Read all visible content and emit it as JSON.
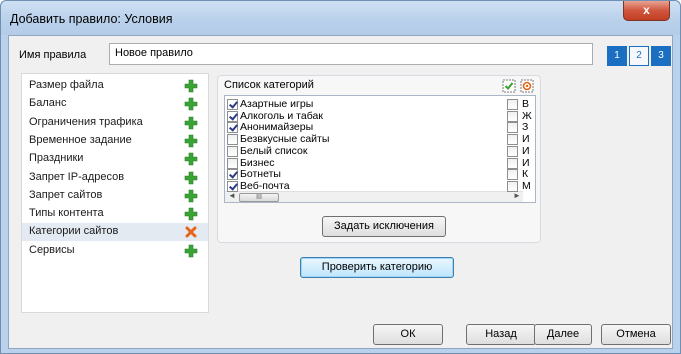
{
  "window": {
    "title": "Добавить правило: Условия",
    "close_glyph": "x"
  },
  "rule_name": {
    "label": "Имя правила",
    "value": "Новое правило"
  },
  "steps": [
    "1",
    "2",
    "3"
  ],
  "sidebar": {
    "items": [
      {
        "label": "Размер файла",
        "icon": "plus-icon"
      },
      {
        "label": "Баланс",
        "icon": "plus-icon"
      },
      {
        "label": "Ограничения трафика",
        "icon": "plus-icon"
      },
      {
        "label": "Временное задание",
        "icon": "plus-icon"
      },
      {
        "label": "Праздники",
        "icon": "plus-icon"
      },
      {
        "label": "Запрет IP-адресов",
        "icon": "plus-icon"
      },
      {
        "label": "Запрет сайтов",
        "icon": "plus-icon"
      },
      {
        "label": "Типы контента",
        "icon": "plus-icon"
      },
      {
        "label": "Категории сайтов",
        "icon": "remove-icon",
        "selected": true
      },
      {
        "label": "Сервисы",
        "icon": "plus-icon"
      }
    ]
  },
  "categories": {
    "title": "Список категорий",
    "items": [
      {
        "label": "Азартные игры",
        "checked": true
      },
      {
        "label": "Алкоголь и табак",
        "checked": true
      },
      {
        "label": "Анонимайзеры",
        "checked": true
      },
      {
        "label": "Безвкусные сайты",
        "checked": false
      },
      {
        "label": "Белый список",
        "checked": false
      },
      {
        "label": "Бизнес",
        "checked": false
      },
      {
        "label": "Ботнеты",
        "checked": true
      },
      {
        "label": "Веб-почта",
        "checked": true
      }
    ],
    "column2": [
      {
        "label": "В",
        "checked": false
      },
      {
        "label": "Ж",
        "checked": false
      },
      {
        "label": "З",
        "checked": false
      },
      {
        "label": "И",
        "checked": false
      },
      {
        "label": "И",
        "checked": false
      },
      {
        "label": "И",
        "checked": false
      },
      {
        "label": "К",
        "checked": false
      },
      {
        "label": "М",
        "checked": false
      }
    ],
    "scroll_left": "◄",
    "scroll_thumb": "III",
    "scroll_right": "►",
    "exceptions_button": "Задать исключения"
  },
  "check_category_button": "Проверить категорию",
  "footer": {
    "ok": "ОК",
    "back": "Назад",
    "next": "Далее",
    "cancel": "Отмена"
  },
  "colors": {
    "accent": "#1b6fc2",
    "plus": "#3aa335",
    "remove": "#e8641b"
  }
}
